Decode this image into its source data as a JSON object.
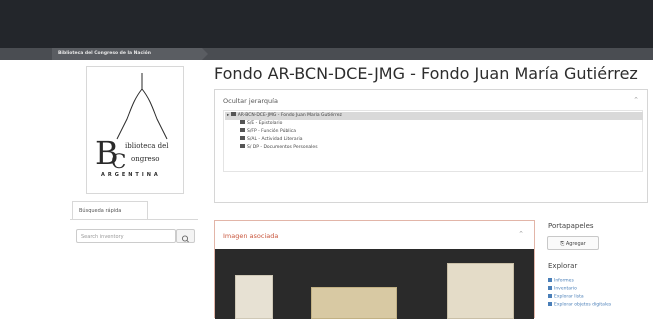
{
  "header": {
    "site_name": "Biblioteca del Congreso de la Nación"
  },
  "logo": {
    "line1": "iblioteca del",
    "line2": "ongreso",
    "line3": "ARGENTINA",
    "letters_b": "B",
    "letters_c": "C"
  },
  "quick_search": {
    "tab_label": "Búsqueda rápida",
    "placeholder": "Search inventory"
  },
  "page": {
    "title": "Fondo AR-BCN-DCE-JMG - Fondo Juan María Gutiérrez"
  },
  "hierarchy": {
    "toggle_label": "Ocultar jerarquía",
    "items": [
      {
        "label": "AR-BCN-DCE-JMG - Fondo Juan María Gutiérrez"
      },
      {
        "label": "S/E - Epistolario"
      },
      {
        "label": "S/FP - Función Pública"
      },
      {
        "label": "S/AL - Actividad Literaria"
      },
      {
        "label": "S/ DP - Documentos Personales"
      }
    ]
  },
  "image_panel": {
    "title": "Imagen asociada"
  },
  "clipboard": {
    "title": "Portapapeles",
    "add_label": "Agregar"
  },
  "explore": {
    "title": "Explorar",
    "links": [
      {
        "label": "Informes"
      },
      {
        "label": "Inventario"
      },
      {
        "label": "Explorar lista"
      },
      {
        "label": "Explorar objetos digitales"
      }
    ]
  }
}
